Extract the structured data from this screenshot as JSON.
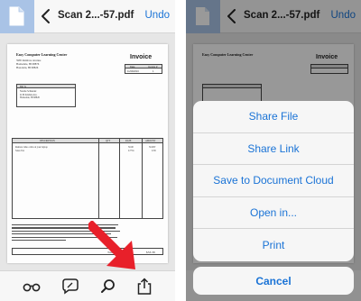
{
  "header": {
    "file_name": "Scan 2...-57.pdf",
    "undo_label": "Undo"
  },
  "document": {
    "company": "Easy Computer Learning Center",
    "address_lines": [
      "5985 Rainbow Avenue",
      "Homedale, HI 98876",
      "Honolulu, HI 98826"
    ],
    "invoice_title": "Invoice",
    "invoice_header_date": "Date",
    "invoice_header_number": "Invoice #",
    "invoice_date": "11/30/2016",
    "invoice_number": "1",
    "bill_to_label": "Bill To",
    "bill_to_lines": [
      "Natalie Schneider",
      "4136 Krishna Ave.",
      "Homedale, HI 98826"
    ],
    "columns": [
      "DESCRIPTION",
      "QTY",
      "RATE",
      "AMOUNT"
    ],
    "rows": [
      {
        "desc": "Remote video calls on your laptop",
        "rate": "50.00",
        "amount": "50.00T"
      },
      {
        "desc": "Sales Tax",
        "rate": "0.75%",
        "amount": "0.38"
      }
    ],
    "total_label": "Total",
    "total_value": "$53.38"
  },
  "toolbar": {
    "icons": [
      "glasses-icon",
      "comment-icon",
      "search-icon",
      "share-icon"
    ]
  },
  "share_sheet": {
    "items": [
      "Share File",
      "Share Link",
      "Save to Document Cloud",
      "Open in...",
      "Print"
    ],
    "cancel_label": "Cancel"
  },
  "colors": {
    "accent": "#1a73d6",
    "doc_tab": "#a9c3e6",
    "arrow": "#e8202a"
  }
}
